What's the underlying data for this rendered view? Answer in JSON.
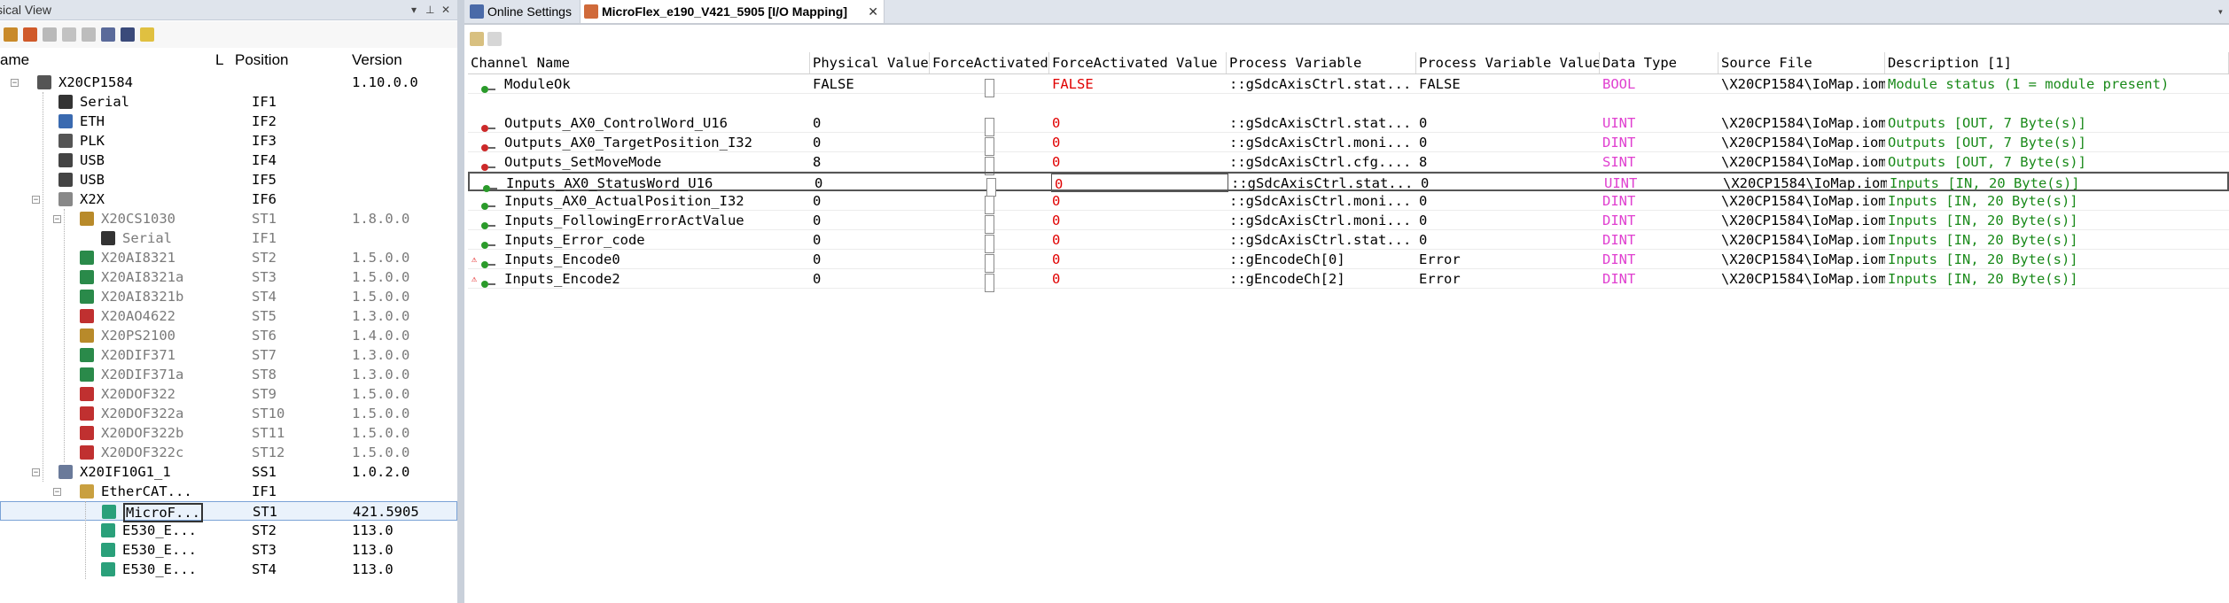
{
  "left_panel": {
    "title": "sical View",
    "columns": {
      "name": "ame",
      "l": "L",
      "position": "Position",
      "version": "Version"
    },
    "tree": [
      {
        "name": "X20CP1584",
        "position": "",
        "version": "1.10.0.0",
        "gray": false
      },
      {
        "name": "Serial",
        "position": "IF1",
        "version": "",
        "gray": false
      },
      {
        "name": "ETH",
        "position": "IF2",
        "version": "",
        "gray": false
      },
      {
        "name": "PLK",
        "position": "IF3",
        "version": "",
        "gray": false
      },
      {
        "name": "USB",
        "position": "IF4",
        "version": "",
        "gray": false
      },
      {
        "name": "USB",
        "position": "IF5",
        "version": "",
        "gray": false
      },
      {
        "name": "X2X",
        "position": "IF6",
        "version": "",
        "gray": false
      },
      {
        "name": "X20CS1030",
        "position": "ST1",
        "version": "1.8.0.0",
        "gray": true
      },
      {
        "name": "Serial",
        "position": "IF1",
        "version": "",
        "gray": true
      },
      {
        "name": "X20AI8321",
        "position": "ST2",
        "version": "1.5.0.0",
        "gray": true
      },
      {
        "name": "X20AI8321a",
        "position": "ST3",
        "version": "1.5.0.0",
        "gray": true
      },
      {
        "name": "X20AI8321b",
        "position": "ST4",
        "version": "1.5.0.0",
        "gray": true
      },
      {
        "name": "X20AO4622",
        "position": "ST5",
        "version": "1.3.0.0",
        "gray": true
      },
      {
        "name": "X20PS2100",
        "position": "ST6",
        "version": "1.4.0.0",
        "gray": true
      },
      {
        "name": "X20DIF371",
        "position": "ST7",
        "version": "1.3.0.0",
        "gray": true
      },
      {
        "name": "X20DIF371a",
        "position": "ST8",
        "version": "1.3.0.0",
        "gray": true
      },
      {
        "name": "X20DOF322",
        "position": "ST9",
        "version": "1.5.0.0",
        "gray": true
      },
      {
        "name": "X20DOF322a",
        "position": "ST10",
        "version": "1.5.0.0",
        "gray": true
      },
      {
        "name": "X20DOF322b",
        "position": "ST11",
        "version": "1.5.0.0",
        "gray": true
      },
      {
        "name": "X20DOF322c",
        "position": "ST12",
        "version": "1.5.0.0",
        "gray": true
      },
      {
        "name": "X20IF10G1_1",
        "position": "SS1",
        "version": "1.0.2.0",
        "gray": false
      },
      {
        "name": "EtherCAT...",
        "position": "IF1",
        "version": "",
        "gray": false
      },
      {
        "name": "MicroF...",
        "position": "ST1",
        "version": "421.5905",
        "gray": false
      },
      {
        "name": "E530_E...",
        "position": "ST2",
        "version": "113.0",
        "gray": false
      },
      {
        "name": "E530_E...",
        "position": "ST3",
        "version": "113.0",
        "gray": false
      },
      {
        "name": "E530_E...",
        "position": "ST4",
        "version": "113.0",
        "gray": false
      }
    ]
  },
  "tabs": [
    {
      "label": "Online Settings",
      "active": false
    },
    {
      "label": "MicroFlex_e190_V421_5905 [I/O Mapping]",
      "active": true
    }
  ],
  "grid": {
    "columns": [
      "Channel Name",
      "Physical Value",
      "ForceActivated",
      "ForceActivated Value",
      "Process Variable",
      "Process Variable Value",
      "Data Type",
      "Source File",
      "Description [1]"
    ],
    "rows": [
      {
        "name": "ModuleOk",
        "dir": "in",
        "warn": false,
        "phys": "FALSE",
        "forceval": "FALSE",
        "pv": "::gSdcAxisCtrl.stat...",
        "pvval": "FALSE",
        "type": "BOOL",
        "src": "\\X20CP1584\\IoMap.iom",
        "desc": "Module status (1 = module present)"
      },
      {
        "name": "Outputs_AX0_ControlWord_U16",
        "dir": "out",
        "warn": false,
        "phys": "0",
        "forceval": "0",
        "pv": "::gSdcAxisCtrl.stat...",
        "pvval": "0",
        "type": "UINT",
        "src": "\\X20CP1584\\IoMap.iom",
        "desc": "Outputs   [OUT, 7 Byte(s)]"
      },
      {
        "name": "Outputs_AX0_TargetPosition_I32",
        "dir": "out",
        "warn": false,
        "phys": "0",
        "forceval": "0",
        "pv": "::gSdcAxisCtrl.moni...",
        "pvval": "0",
        "type": "DINT",
        "src": "\\X20CP1584\\IoMap.iom",
        "desc": "Outputs   [OUT, 7 Byte(s)]"
      },
      {
        "name": "Outputs_SetMoveMode",
        "dir": "out",
        "warn": false,
        "phys": "8",
        "forceval": "0",
        "pv": "::gSdcAxisCtrl.cfg....",
        "pvval": "8",
        "type": "SINT",
        "src": "\\X20CP1584\\IoMap.iom",
        "desc": "Outputs   [OUT, 7 Byte(s)]"
      },
      {
        "name": "Inputs_AX0_StatusWord_U16",
        "dir": "in",
        "warn": false,
        "phys": "0",
        "forceval": "0",
        "pv": "::gSdcAxisCtrl.stat...",
        "pvval": "0",
        "type": "UINT",
        "src": "\\X20CP1584\\IoMap.iom",
        "desc": "Inputs    [IN, 20 Byte(s)]"
      },
      {
        "name": "Inputs_AX0_ActualPosition_I32",
        "dir": "in",
        "warn": false,
        "phys": "0",
        "forceval": "0",
        "pv": "::gSdcAxisCtrl.moni...",
        "pvval": "0",
        "type": "DINT",
        "src": "\\X20CP1584\\IoMap.iom",
        "desc": "Inputs    [IN, 20 Byte(s)]"
      },
      {
        "name": "Inputs_FollowingErrorActValue",
        "dir": "in",
        "warn": false,
        "phys": "0",
        "forceval": "0",
        "pv": "::gSdcAxisCtrl.moni...",
        "pvval": "0",
        "type": "DINT",
        "src": "\\X20CP1584\\IoMap.iom",
        "desc": "Inputs    [IN, 20 Byte(s)]"
      },
      {
        "name": "Inputs_Error_code",
        "dir": "in",
        "warn": false,
        "phys": "0",
        "forceval": "0",
        "pv": "::gSdcAxisCtrl.stat...",
        "pvval": "0",
        "type": "DINT",
        "src": "\\X20CP1584\\IoMap.iom",
        "desc": "Inputs    [IN, 20 Byte(s)]"
      },
      {
        "name": "Inputs_Encode0",
        "dir": "in",
        "warn": true,
        "phys": "0",
        "forceval": "0",
        "pv": "::gEncodeCh[0]",
        "pvval": "Error",
        "type": "DINT",
        "src": "\\X20CP1584\\IoMap.iom",
        "desc": "Inputs    [IN, 20 Byte(s)]"
      },
      {
        "name": "Inputs_Encode2",
        "dir": "in",
        "warn": true,
        "phys": "0",
        "forceval": "0",
        "pv": "::gEncodeCh[2]",
        "pvval": "Error",
        "type": "DINT",
        "src": "\\X20CP1584\\IoMap.iom",
        "desc": "Inputs    [IN, 20 Byte(s)]"
      }
    ]
  },
  "colors": {
    "accent": "#7aa2d6",
    "red": "#e00000",
    "magenta": "#e040d0",
    "green": "#1a8a1a"
  }
}
